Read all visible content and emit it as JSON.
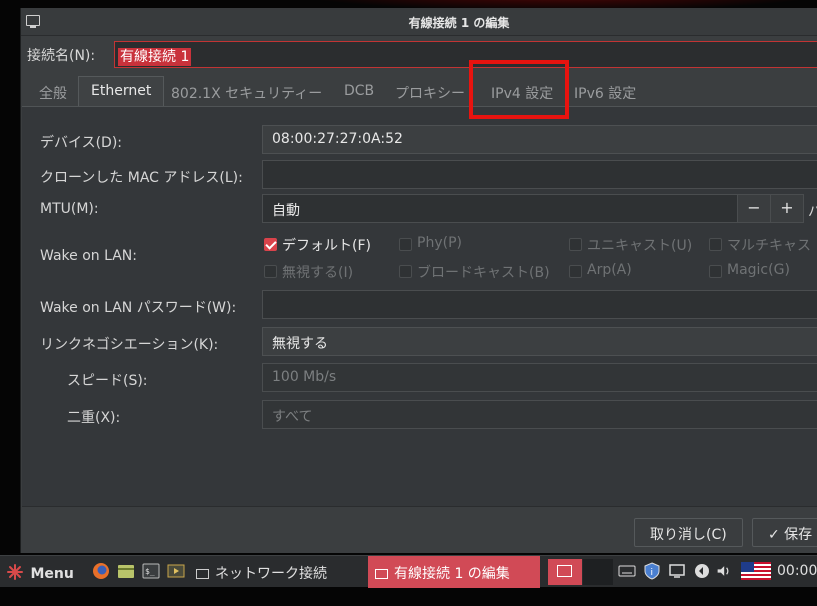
{
  "window": {
    "title": "有線接続 1 の編集"
  },
  "connection": {
    "label": "接続名(N):",
    "value": "有線接続 1"
  },
  "tabs": [
    {
      "label": "全般"
    },
    {
      "label": "Ethernet"
    },
    {
      "label": "802.1X セキュリティー"
    },
    {
      "label": "DCB"
    },
    {
      "label": "プロキシー"
    },
    {
      "label": "IPv4 設定"
    },
    {
      "label": "IPv6 設定"
    }
  ],
  "ethernet": {
    "device_label": "デバイス(D):",
    "device_value": "08:00:27:27:0A:52",
    "clone_label": "クローンした MAC アドレス(L):",
    "clone_value": "",
    "mtu_label": "MTU(M):",
    "mtu_value": "自動",
    "mtu_minus": "−",
    "mtu_plus": "+",
    "mtu_unit": "バ",
    "wol_label": "Wake on LAN:",
    "wol_options": [
      {
        "label": "デフォルト(F)",
        "checked": true
      },
      {
        "label": "Phy(P)",
        "checked": false
      },
      {
        "label": "ユニキャスト(U)",
        "checked": false
      },
      {
        "label": "マルチキャス",
        "checked": false
      },
      {
        "label": "無視する(I)",
        "checked": false
      },
      {
        "label": "ブロードキャスト(B)",
        "checked": false
      },
      {
        "label": "Arp(A)",
        "checked": false
      },
      {
        "label": "Magic(G)",
        "checked": false
      }
    ],
    "wol_password_label": "Wake on LAN パスワード(W):",
    "wol_password_value": "",
    "negotiation_label": "リンクネゴシエーション(K):",
    "negotiation_value": "無視する",
    "speed_label": "スピード(S):",
    "speed_value": "100 Mb/s",
    "duplex_label": "二重(X):",
    "duplex_value": "すべて"
  },
  "buttons": {
    "cancel": "取り消し(C)",
    "save": "✓ 保存"
  },
  "taskbar": {
    "menu_label": "Menu",
    "task_network": "ネットワーク接続",
    "task_edit": "有線接続 1 の編集",
    "clock": "00:00"
  },
  "colors": {
    "accent": "#d9434b",
    "highlight_box": "#e8130f",
    "dialog_bg": "#3b3e40"
  }
}
